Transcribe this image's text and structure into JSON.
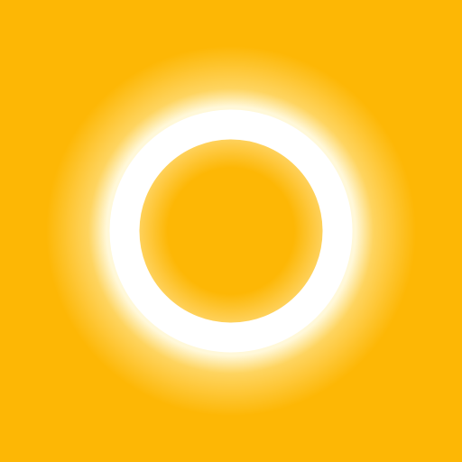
{
  "colors": {
    "background": "#FDB705",
    "ring": "#FFFFFF",
    "glow": "#FFF6D6"
  },
  "icon": {
    "name": "ring-icon"
  }
}
